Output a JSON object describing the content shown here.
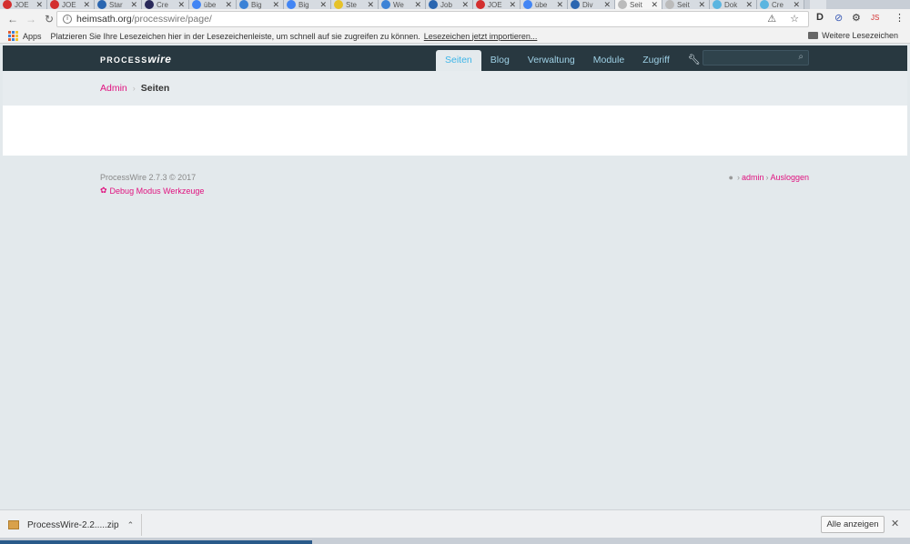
{
  "browser": {
    "tabs": [
      {
        "label": "JOE",
        "color": "#d32f2f"
      },
      {
        "label": "JOE",
        "color": "#d32f2f"
      },
      {
        "label": "Star",
        "color": "#2b66b0"
      },
      {
        "label": "Cre",
        "color": "#2a2a5a"
      },
      {
        "label": "übe",
        "color": "#4285f4"
      },
      {
        "label": "Big",
        "color": "#3b82d6"
      },
      {
        "label": "Big",
        "color": "#4285f4"
      },
      {
        "label": "Ste",
        "color": "#e6c229"
      },
      {
        "label": "We",
        "color": "#3b82d6"
      },
      {
        "label": "Job",
        "color": "#2b66b0"
      },
      {
        "label": "JOE",
        "color": "#d32f2f"
      },
      {
        "label": "übe",
        "color": "#4285f4"
      },
      {
        "label": "Div",
        "color": "#2b66b0"
      },
      {
        "label": "Seit",
        "color": "#bbbbbb"
      },
      {
        "label": "Seit",
        "color": "#bbbbbb"
      },
      {
        "label": "Dok",
        "color": "#5bb5e0"
      },
      {
        "label": "Cre",
        "color": "#5bb5e0"
      }
    ],
    "tab_close": "✕",
    "url_host": "heimsath.org",
    "url_path": "/processwire/page/",
    "omnibox_icons": "⚠ ☆",
    "ext_js": "JS"
  },
  "bookmarks": {
    "apps": "Apps",
    "hint": "Platzieren Sie Ihre Lesezeichen hier in der Lesezeichenleiste, um schnell auf sie zugreifen zu können.",
    "import_link": "Lesezeichen jetzt importieren...",
    "other": "Weitere Lesezeichen"
  },
  "pw": {
    "logo_a": "PROCESS",
    "logo_b": "wire",
    "nav": [
      "Seiten",
      "Blog",
      "Verwaltung",
      "Module",
      "Zugriff"
    ],
    "breadcrumb_admin": "Admin",
    "breadcrumb_current": "Seiten",
    "version": "ProcessWire 2.7.3 © 2017",
    "debug": "Debug Modus Werkzeuge",
    "user": "admin",
    "logout": "Ausloggen"
  },
  "downloads": {
    "file": "ProcessWire-2.2.....zip",
    "show_all": "Alle anzeigen"
  },
  "colors": {
    "accent": "#e0127f",
    "header_bg": "#283840",
    "nav_active": "#3cb5e8"
  }
}
